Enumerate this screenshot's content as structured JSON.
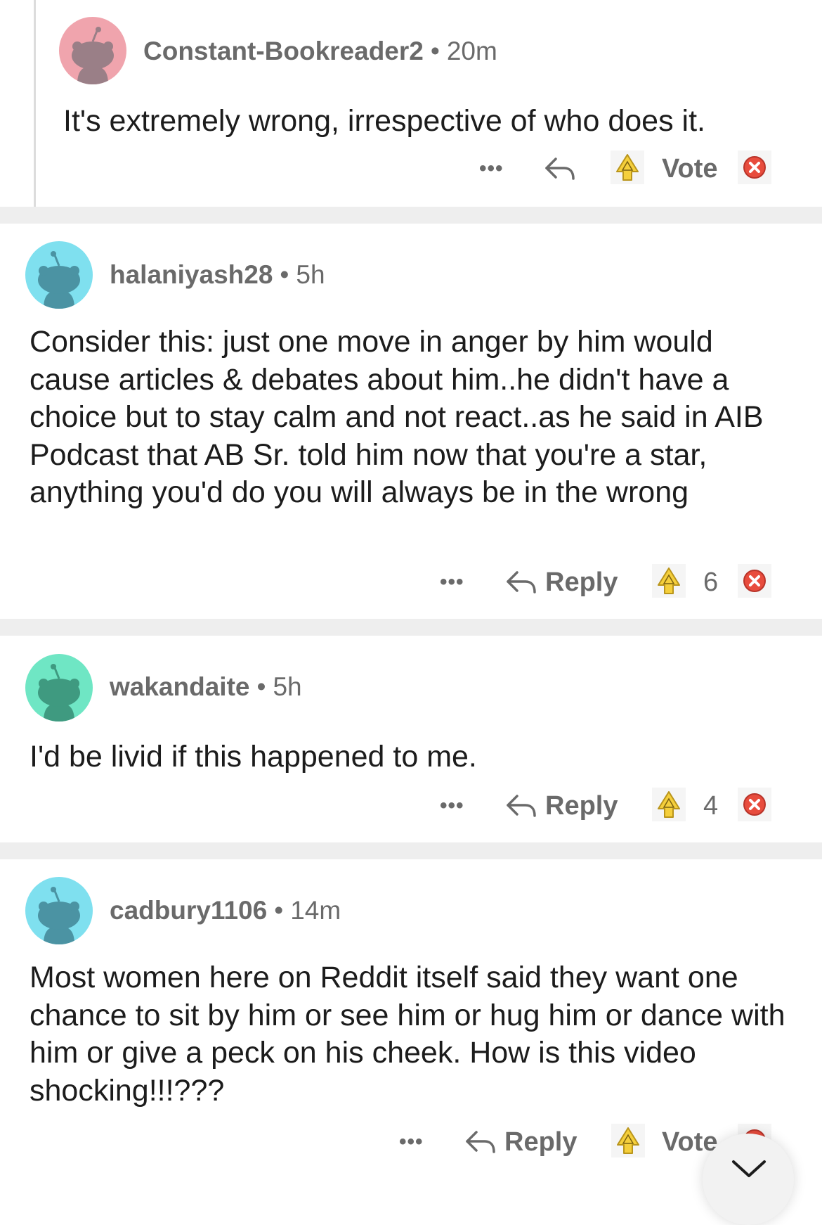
{
  "colors": {
    "avatar_pink": "#f0a4ad",
    "avatar_blue": "#7fe0ef",
    "avatar_green": "#6fe6c4",
    "muted_text": "#6a6a6a",
    "divider": "#eeeeee",
    "downvote_red": "#e84c3d"
  },
  "comments": [
    {
      "username": "Constant-Bookreader2",
      "separator": "•",
      "time": "20m",
      "body": "It's extremely wrong, irrespective of who does it.",
      "avatar_icon": "snoo-avatar-icon",
      "actions": {
        "more": "•••",
        "reply_icon": "reply-arrow-icon",
        "upvote_icon": "upvote-icon",
        "vote_label": "Vote",
        "downvote_icon": "downvote-icon"
      }
    },
    {
      "username": "halaniyash28",
      "separator": "•",
      "time": "5h",
      "body": "Consider this: just one move in anger by him would cause articles & debates about him..he didn't have a choice but to stay calm and not react..as he said in AIB Podcast that AB Sr. told him now that you're a star, anything you'd do you will always be in the wrong",
      "avatar_icon": "snoo-avatar-icon",
      "actions": {
        "more": "•••",
        "reply_label": "Reply",
        "vote_count": "6"
      }
    },
    {
      "username": "wakandaite",
      "separator": "•",
      "time": "5h",
      "body": "I'd be livid if this happened to me.",
      "avatar_icon": "snoo-avatar-icon",
      "actions": {
        "more": "•••",
        "reply_label": "Reply",
        "vote_count": "4"
      }
    },
    {
      "username": "cadbury1106",
      "separator": "•",
      "time": "14m",
      "body": "Most women here on Reddit itself said they want one chance to sit by him or see him or hug him or dance with him or give a peck on his cheek. How is this video shocking!!!???",
      "avatar_icon": "snoo-avatar-icon",
      "actions": {
        "more": "•••",
        "reply_label": "Reply",
        "vote_label": "Vote"
      }
    }
  ],
  "scroll_button": {
    "icon": "chevron-down-icon"
  }
}
